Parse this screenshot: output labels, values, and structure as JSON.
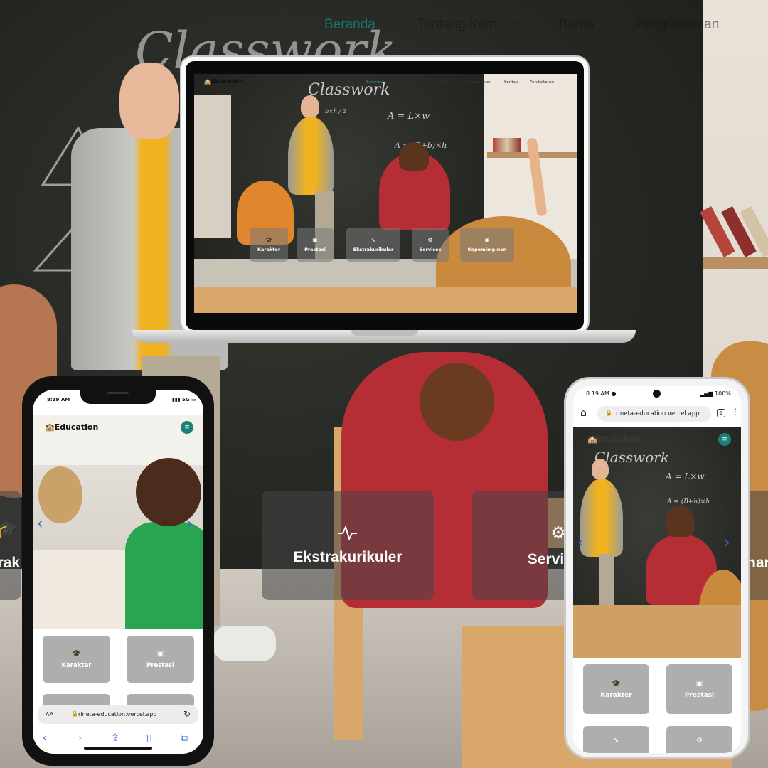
{
  "background_site": {
    "nav": {
      "home": "Beranda",
      "about": "Tentang Kami",
      "about_caret": "⌄",
      "news": "Berita",
      "announcements": "Pengumuman"
    },
    "cards": {
      "left_partial": "rak",
      "extracurricular": "Ekstrakurikuler",
      "services": "Services",
      "right_partial": "har"
    },
    "chalkboard_text": "Classwork"
  },
  "laptop": {
    "logo": "Education",
    "nav": [
      "Beranda",
      "Tentang Kami",
      "Berita",
      "Pengumuman",
      "Kontak",
      "Pendaftaran"
    ],
    "chalk": {
      "title": "Classwork",
      "formula1": "A = L×w",
      "formula2": "A = (B+b)×h",
      "fraction": "b×h / 2"
    },
    "cards": [
      "Karakter",
      "Prestasi",
      "Ekstrakurikuler",
      "Services",
      "Kepemimpinan"
    ]
  },
  "iphone": {
    "time": "8:19 AM",
    "signal": "5G",
    "logo": "Education",
    "cards": [
      "Karakter",
      "Prestasi"
    ],
    "url_aa": "AA",
    "url": "rineta-education.vercel.app"
  },
  "android": {
    "time": "8:19 AM",
    "battery": "100%",
    "url": "rineta-education.vercel.app",
    "tab_count": "1",
    "logo": "Education",
    "chalk": {
      "title": "Classwork",
      "formula1": "A = L×w",
      "formula2": "A = (B+b)×h"
    },
    "cards": [
      "Karakter",
      "Prestasi"
    ]
  },
  "icons": {
    "graduate": "graduate-icon",
    "certificate": "certificate-icon",
    "activity": "activity-icon",
    "services": "services-icon",
    "leadership": "leadership-icon"
  },
  "colors": {
    "accent": "#1d8077",
    "nav_active": "#14756e",
    "link_blue": "#2b6fc9",
    "card_grey": "#aeaeae"
  }
}
